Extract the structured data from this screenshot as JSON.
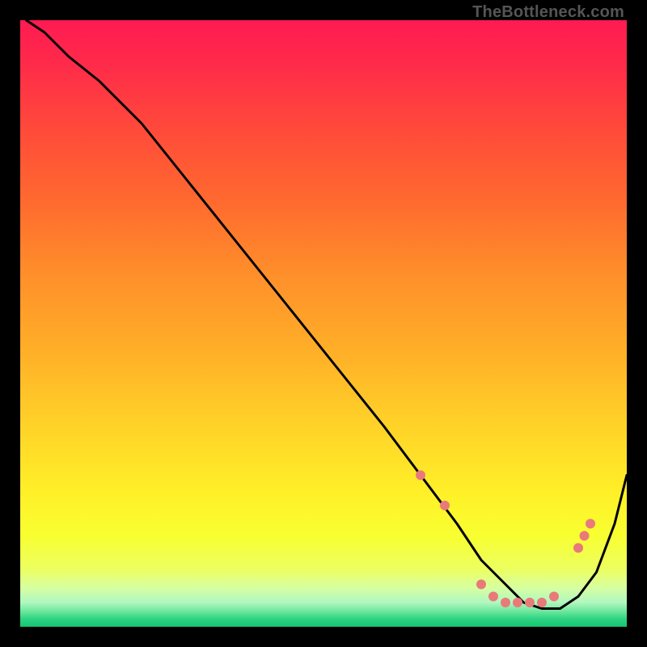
{
  "watermark": "TheBottleneck.com",
  "gradient_stops": [
    {
      "offset": 0.0,
      "color": "#ff1a52"
    },
    {
      "offset": 0.07,
      "color": "#ff2a4a"
    },
    {
      "offset": 0.18,
      "color": "#ff4a3a"
    },
    {
      "offset": 0.3,
      "color": "#ff6a2f"
    },
    {
      "offset": 0.42,
      "color": "#ff8f2a"
    },
    {
      "offset": 0.55,
      "color": "#ffb028"
    },
    {
      "offset": 0.67,
      "color": "#ffd328"
    },
    {
      "offset": 0.78,
      "color": "#fff028"
    },
    {
      "offset": 0.85,
      "color": "#f8ff30"
    },
    {
      "offset": 0.905,
      "color": "#ecff60"
    },
    {
      "offset": 0.935,
      "color": "#d8ffa0"
    },
    {
      "offset": 0.96,
      "color": "#b0f7c0"
    },
    {
      "offset": 0.975,
      "color": "#6ae79a"
    },
    {
      "offset": 0.987,
      "color": "#2ed383"
    },
    {
      "offset": 1.0,
      "color": "#14c56f"
    }
  ],
  "chart_data": {
    "type": "line",
    "title": "",
    "xlabel": "",
    "ylabel": "",
    "xlim": [
      0,
      100
    ],
    "ylim": [
      0,
      100
    ],
    "series": [
      {
        "name": "bottleneck-curve",
        "x": [
          1,
          4,
          8,
          13,
          20,
          28,
          36,
          44,
          52,
          60,
          66,
          72,
          76,
          80,
          83,
          86,
          89,
          92,
          95,
          98,
          100
        ],
        "y": [
          100,
          98,
          94,
          90,
          83,
          73,
          63,
          53,
          43,
          33,
          25,
          17,
          11,
          7,
          4,
          3,
          3,
          5,
          9,
          17,
          25
        ]
      }
    ],
    "markers": {
      "name": "highlight-points",
      "color": "#e97a7a",
      "x": [
        66,
        70,
        76,
        78,
        80,
        82,
        84,
        86,
        88,
        92,
        93,
        94
      ],
      "y": [
        25,
        20,
        7,
        5,
        4,
        4,
        4,
        4,
        5,
        13,
        15,
        17
      ]
    }
  },
  "colors": {
    "curve": "#000000",
    "marker": "#e97a7a",
    "background_frame": "#000000"
  }
}
